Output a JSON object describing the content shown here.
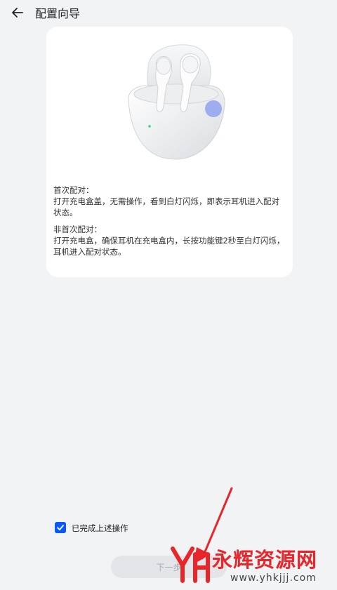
{
  "header": {
    "title": "配置向导",
    "back_icon": "back-arrow-icon"
  },
  "card": {
    "image": "earbuds-charging-case-illustration",
    "first_pair_title": "首次配对：",
    "first_pair_text": "打开充电盒盖，无需操作，看到白灯闪烁，即表示耳机进入配对状态。",
    "repeat_pair_title": "非首次配对：",
    "repeat_pair_text": "打开充电盒，确保耳机在充电盒内，长按功能键2秒至白灯闪烁，耳机进入配对状态。"
  },
  "confirm": {
    "label": "已完成上述操作",
    "checked": true,
    "accent_color": "#0a59f7"
  },
  "next_button": {
    "label": "下一步"
  },
  "watermark": {
    "text": "永辉资源网",
    "url": "www.yhkjjj.com",
    "color": "#e8262a"
  }
}
